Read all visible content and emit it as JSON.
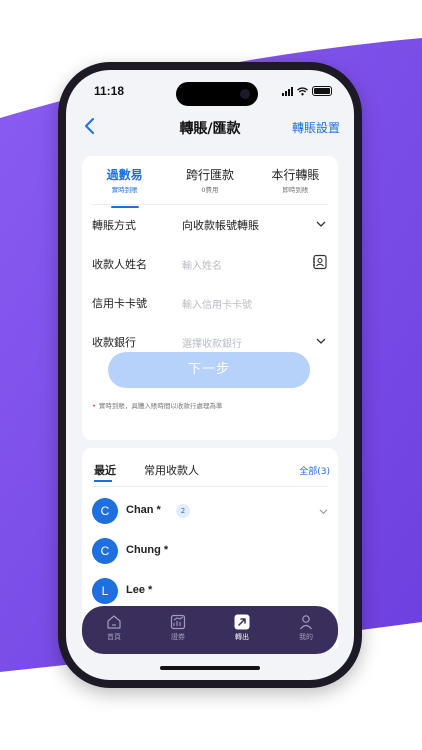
{
  "status": {
    "time": "11:18"
  },
  "nav": {
    "title": "轉賬/匯款",
    "settings": "轉賬設置"
  },
  "tabs": [
    {
      "title": "過數易",
      "subtitle": "實時到賬"
    },
    {
      "title": "跨行匯款",
      "subtitle": "0費用"
    },
    {
      "title": "本行轉賬",
      "subtitle": "即時到賬"
    }
  ],
  "form": {
    "method_label": "轉賬方式",
    "method_value": "向收款帳號轉賬",
    "payee_label": "收款人姓名",
    "payee_placeholder": "輸入姓名",
    "card_label": "信用卡卡號",
    "card_placeholder": "輸入信用卡卡號",
    "bank_label": "收款銀行",
    "bank_placeholder": "選擇收款銀行"
  },
  "next_button": "下一步",
  "note": "實時到賬，具體入賬時間以收款行處理為準",
  "recent": {
    "tab_recent": "最近",
    "tab_common": "常用收款人",
    "all_link": "全部(3)",
    "contacts": [
      {
        "initial": "C",
        "name": "Chan *",
        "count": "2"
      },
      {
        "initial": "C",
        "name": "Chung *"
      },
      {
        "initial": "L",
        "name": "Lee *"
      }
    ]
  },
  "tabbar": [
    "首頁",
    "證券",
    "轉出",
    "我的"
  ],
  "colors": {
    "accent": "#1e6fe0",
    "purple": "#7c4fe6",
    "tabbar": "#3a2f5c"
  }
}
